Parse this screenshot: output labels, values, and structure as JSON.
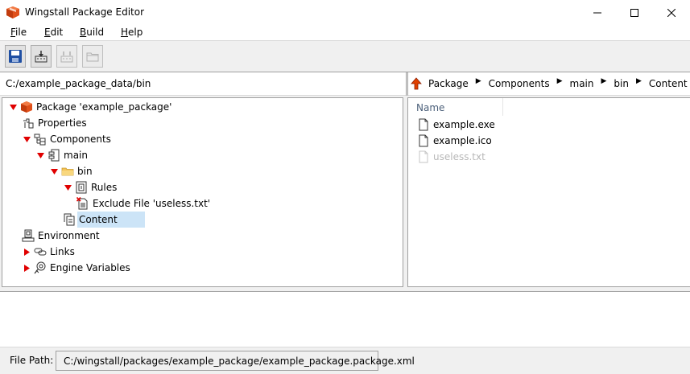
{
  "window": {
    "title": "Wingstall Package Editor",
    "icon": "package-box-icon"
  },
  "menu": {
    "items": [
      {
        "label": "File",
        "mnemonic": "F",
        "rest": "ile"
      },
      {
        "label": "Edit",
        "mnemonic": "E",
        "rest": "dit"
      },
      {
        "label": "Build",
        "mnemonic": "B",
        "rest": "uild"
      },
      {
        "label": "Help",
        "mnemonic": "H",
        "rest": "elp"
      }
    ]
  },
  "toolbar": {
    "buttons": [
      {
        "icon": "save-icon",
        "enabled": true
      },
      {
        "icon": "build-icon",
        "enabled": true
      },
      {
        "icon": "build-disabled-icon",
        "enabled": false
      },
      {
        "icon": "open-folder-icon",
        "enabled": false
      }
    ]
  },
  "location": {
    "path": "C:/example_package_data/bin",
    "breadcrumbs": [
      "Package",
      "Components",
      "main",
      "bin",
      "Content"
    ]
  },
  "tree": {
    "items": [
      {
        "label": "Package 'example_package'",
        "icon": "package-icon",
        "expander": "expanded",
        "depth": 0
      },
      {
        "label": "Properties",
        "icon": "properties-icon",
        "expander": "none",
        "depth": 1
      },
      {
        "label": "Components",
        "icon": "components-icon",
        "expander": "expanded",
        "depth": 1
      },
      {
        "label": "main",
        "icon": "component-icon",
        "expander": "expanded",
        "depth": 2
      },
      {
        "label": "bin",
        "icon": "folder-icon",
        "expander": "expanded",
        "depth": 3
      },
      {
        "label": "Rules",
        "icon": "rules-icon",
        "expander": "expanded",
        "depth": 4
      },
      {
        "label": "Exclude File 'useless.txt'",
        "icon": "exclude-file-icon",
        "expander": "none",
        "depth": 5
      },
      {
        "label": "Content",
        "icon": "content-icon",
        "expander": "none",
        "depth": 4,
        "selected": true
      },
      {
        "label": "Environment",
        "icon": "environment-icon",
        "expander": "none",
        "depth": 1
      },
      {
        "label": "Links",
        "icon": "links-icon",
        "expander": "collapsed",
        "depth": 1
      },
      {
        "label": "Engine Variables",
        "icon": "engine-variables-icon",
        "expander": "collapsed",
        "depth": 1
      }
    ]
  },
  "file_list": {
    "column_header": "Name",
    "files": [
      {
        "name": "example.exe",
        "icon": "file-icon",
        "excluded": false
      },
      {
        "name": "example.ico",
        "icon": "file-icon",
        "excluded": false
      },
      {
        "name": "useless.txt",
        "icon": "file-icon",
        "excluded": true
      }
    ]
  },
  "status": {
    "label": "File Path:",
    "value": "C:/wingstall/packages/example_package/example_package.package.xml"
  },
  "colors": {
    "expander_red": "#e00000",
    "selection": "#cce4f7",
    "package_orange": "#e0501a",
    "folder_yellow": "#f4c45a"
  }
}
